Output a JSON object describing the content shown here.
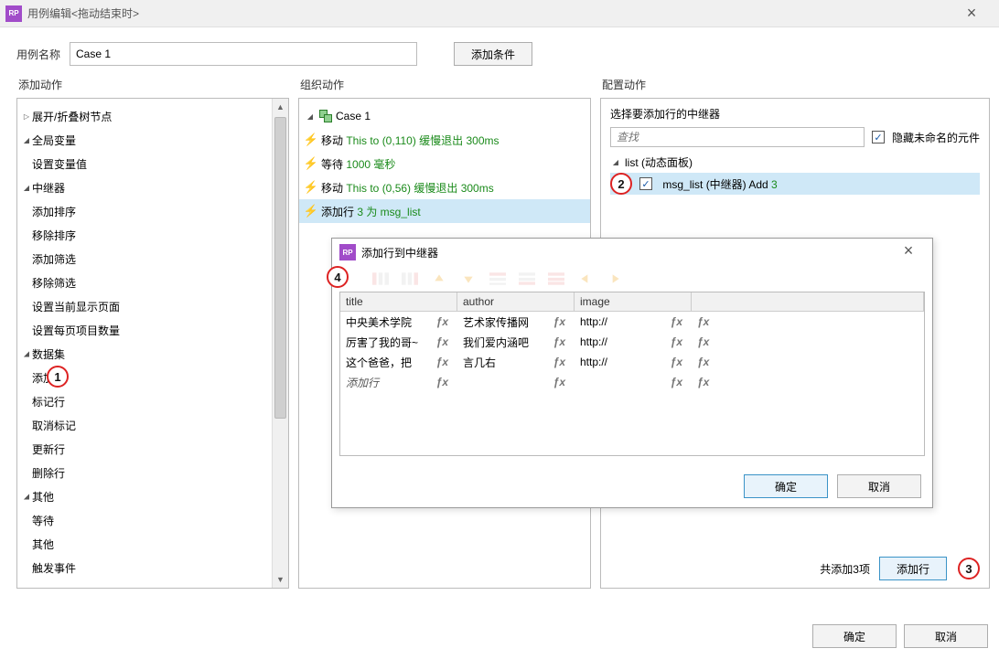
{
  "window": {
    "title": "用例编辑<拖动结束时>"
  },
  "name_row": {
    "label": "用例名称",
    "value": "Case 1",
    "add_condition": "添加条件"
  },
  "sections": {
    "add_actions": "添加动作",
    "organize_actions": "组织动作",
    "configure_actions": "配置动作"
  },
  "left_tree": {
    "items": [
      {
        "depth": 2,
        "exp": "",
        "label": "展开/折叠树节点",
        "pre_exp": "right"
      },
      {
        "depth": 1,
        "exp": "down",
        "label": "全局变量"
      },
      {
        "depth": 2,
        "exp": "",
        "label": "设置变量值"
      },
      {
        "depth": 1,
        "exp": "down",
        "label": "中继器"
      },
      {
        "depth": 2,
        "exp": "",
        "label": "添加排序"
      },
      {
        "depth": 2,
        "exp": "",
        "label": "移除排序"
      },
      {
        "depth": 2,
        "exp": "",
        "label": "添加筛选"
      },
      {
        "depth": 2,
        "exp": "",
        "label": "移除筛选"
      },
      {
        "depth": 2,
        "exp": "",
        "label": "设置当前显示页面"
      },
      {
        "depth": 2,
        "exp": "",
        "label": "设置每页项目数量"
      },
      {
        "depth": 2,
        "exp": "down",
        "label": "数据集"
      },
      {
        "depth": 3,
        "exp": "",
        "label": "添加行",
        "anno": 1
      },
      {
        "depth": 3,
        "exp": "",
        "label": "标记行"
      },
      {
        "depth": 3,
        "exp": "",
        "label": "取消标记"
      },
      {
        "depth": 3,
        "exp": "",
        "label": "更新行"
      },
      {
        "depth": 3,
        "exp": "",
        "label": "删除行"
      },
      {
        "depth": 1,
        "exp": "down",
        "label": "其他"
      },
      {
        "depth": 2,
        "exp": "",
        "label": "等待"
      },
      {
        "depth": 2,
        "exp": "",
        "label": "其他"
      },
      {
        "depth": 2,
        "exp": "",
        "label": "触发事件"
      }
    ]
  },
  "middle_tree": {
    "case_label": "Case 1",
    "actions": [
      {
        "pre": "移动 ",
        "green": "This to (0,110) 缓慢退出 300ms"
      },
      {
        "pre": "等待 ",
        "green": "1000 毫秒"
      },
      {
        "pre": "移动 ",
        "green": "This to (0,56) 缓慢退出 300ms"
      },
      {
        "pre": "添加行 ",
        "green": "3 为 msg_list",
        "sel": true
      }
    ]
  },
  "right_panel": {
    "header": "选择要添加行的中继器",
    "search_placeholder": "查找",
    "hide_unnamed": "隐藏未命名的元件",
    "tree": {
      "parent": "list (动态面板)",
      "child_pre": "msg_list (中继器) Add ",
      "child_green": "3",
      "anno": 2
    },
    "footer": {
      "summary": "共添加3项",
      "add_row": "添加行",
      "anno": 3
    }
  },
  "modal": {
    "title": "添加行到中继器",
    "anno": 4,
    "columns": [
      "title",
      "author",
      "image",
      ""
    ],
    "rows": [
      {
        "c1": "中央美术学院",
        "c2": "艺术家传播网",
        "c3": "http://",
        "c4": ""
      },
      {
        "c1": "厉害了我的哥~",
        "c2": "我们爱内涵吧",
        "c3": "http://",
        "c4": ""
      },
      {
        "c1": "这个爸爸，把",
        "c2": "言几右",
        "c3": "http://",
        "c4": ""
      }
    ],
    "add_row_label": "添加行",
    "fx": "ƒx",
    "ok": "确定",
    "cancel": "取消"
  },
  "buttons": {
    "ok": "确定",
    "cancel": "取消"
  }
}
